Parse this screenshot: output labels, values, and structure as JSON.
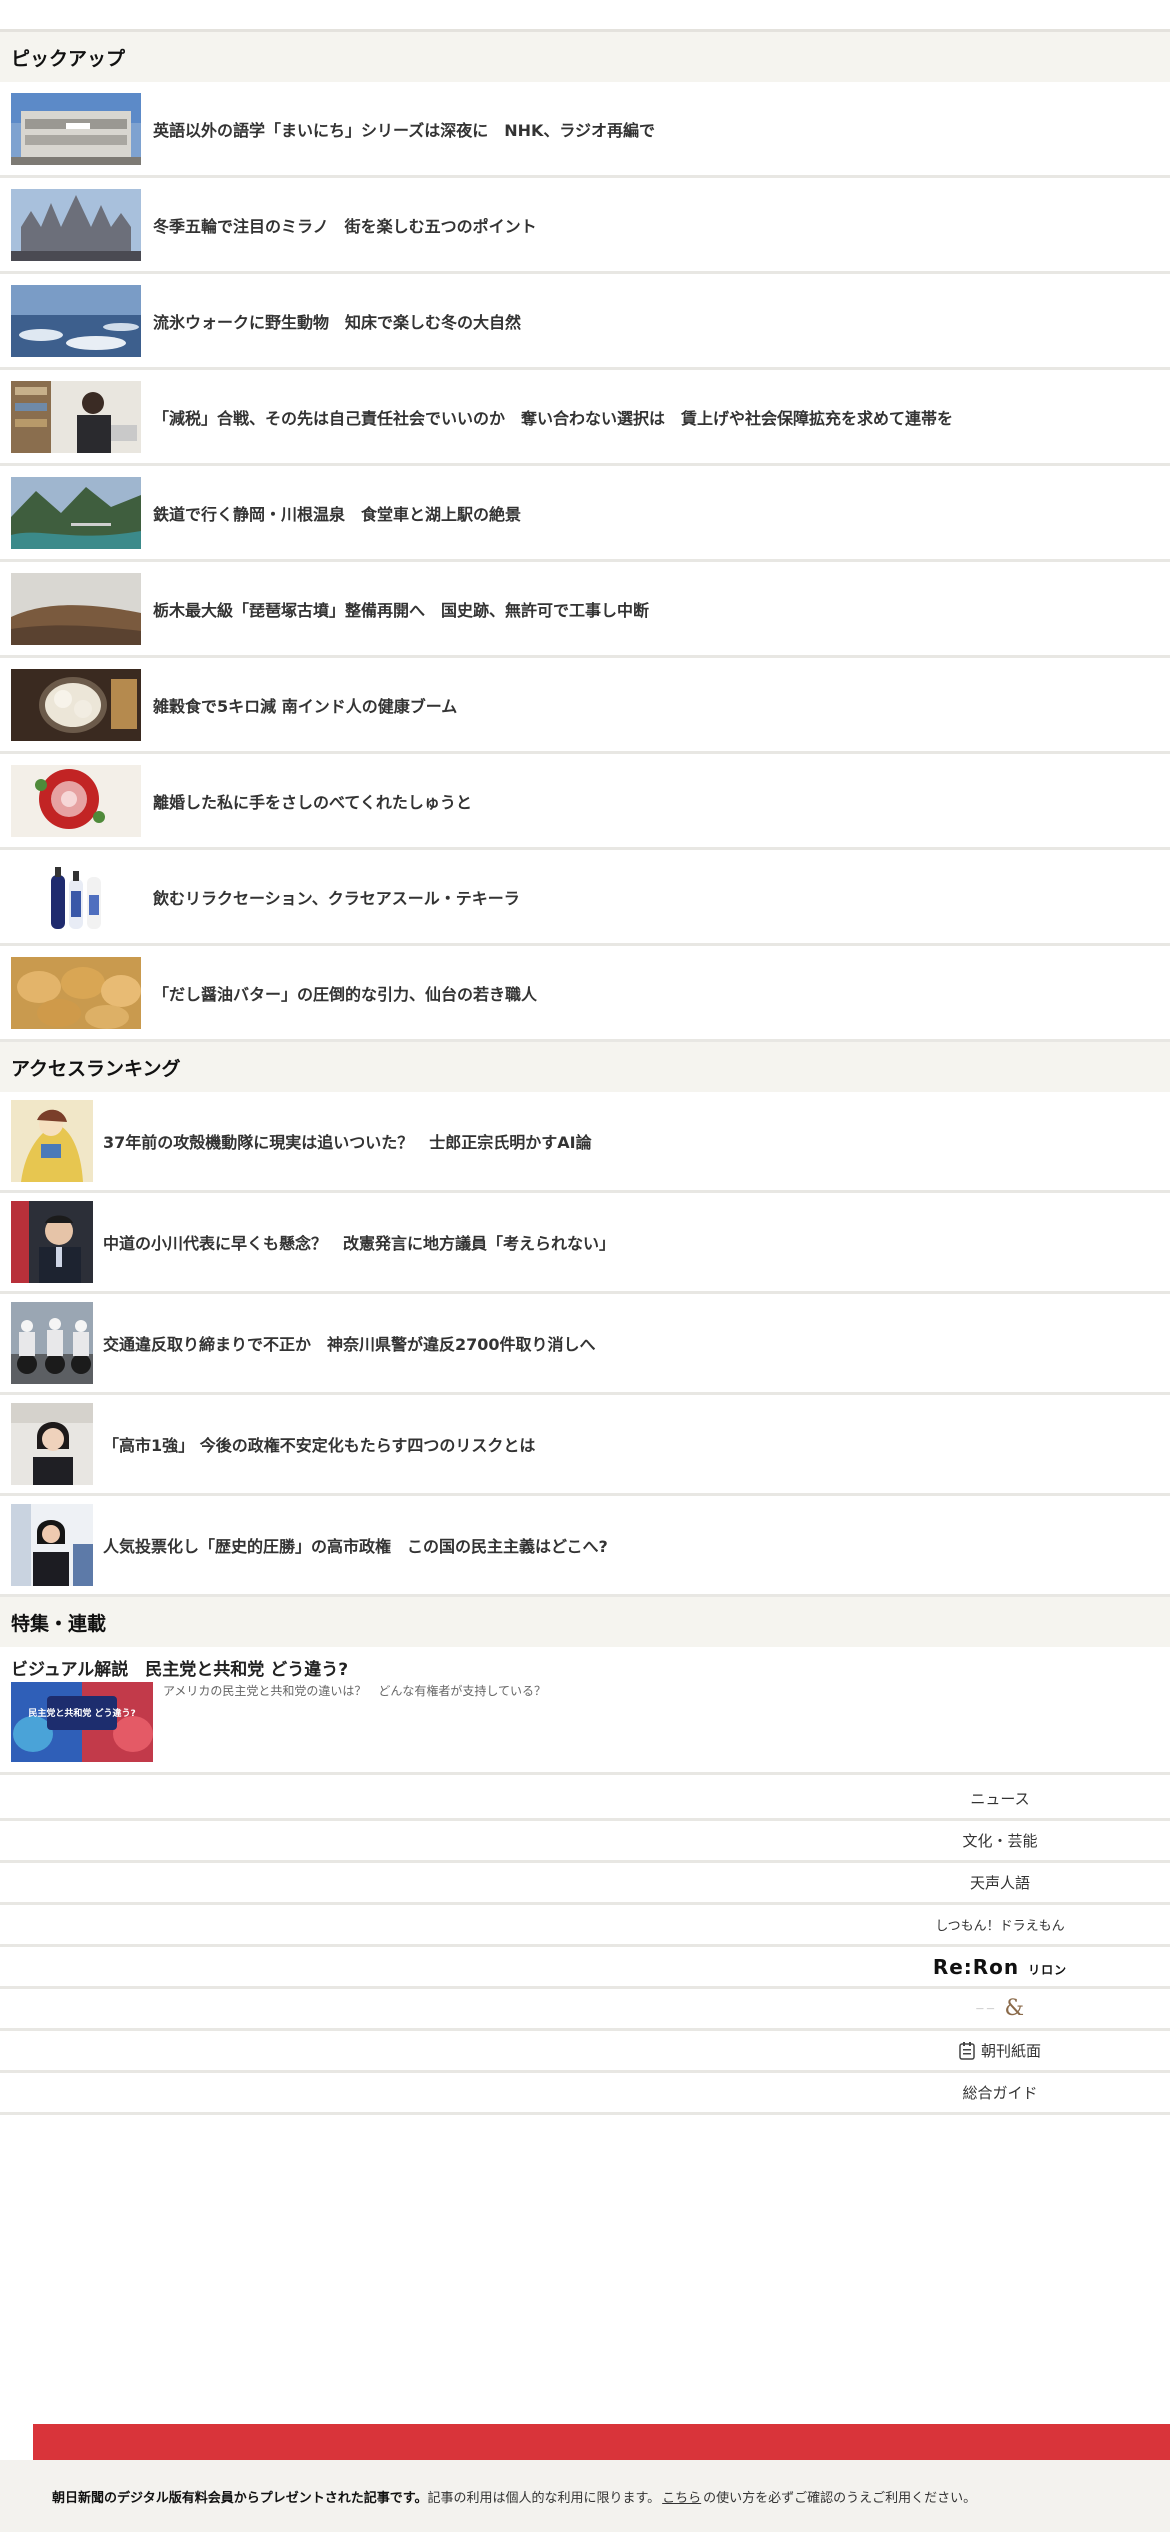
{
  "pickup": {
    "header": "ピックアップ",
    "items": [
      {
        "title": "英語以外の語学「まいにち」シリーズは深夜に　NHK、ラジオ再編で"
      },
      {
        "title": "冬季五輪で注目のミラノ　街を楽しむ五つのポイント"
      },
      {
        "title": "流氷ウォークに野生動物　知床で楽しむ冬の大自然"
      },
      {
        "title": "「減税」合戦、その先は自己責任社会でいいのか　奪い合わない選択は　賃上げや社会保障拡充を求めて連帯を"
      },
      {
        "title": "鉄道で行く静岡・川根温泉　食堂車と湖上駅の絶景"
      },
      {
        "title": "栃木最大級「琵琶塚古墳」整備再開へ　国史跡、無許可で工事し中断"
      },
      {
        "title": "雑穀食で5キロ減 南インド人の健康ブーム"
      },
      {
        "title": "離婚した私に手をさしのべてくれたしゅうと"
      },
      {
        "title": "飲むリラクセーション、クラセアスール・テキーラ"
      },
      {
        "title": "「だし醤油バター」の圧倒的な引力、仙台の若き職人"
      }
    ]
  },
  "ranking": {
    "header": "アクセスランキング",
    "items": [
      {
        "title": "37年前の攻殻機動隊に現実は追いついた？　士郎正宗氏明かすAI論"
      },
      {
        "title": "中道の小川代表に早くも懸念？　改憲発言に地方議員「考えられない」"
      },
      {
        "title": "交通違反取り締まりで不正か　神奈川県警が違反2700件取り消しへ"
      },
      {
        "title": "「高市1強」 今後の政権不安定化もたらす四つのリスクとは"
      },
      {
        "title": "人気投票化し「歴史的圧勝」の高市政権　この国の民主主義はどこへ?"
      }
    ]
  },
  "feature": {
    "header": "特集・連載",
    "title": "ビジュアル解説　民主党と共和党 どう違う?",
    "description": "アメリカの民主党と共和党の違いは？　どんな有権者が支持している？",
    "thumb_text": "民主党と共和党 どう違う?"
  },
  "nav": {
    "items": [
      "ニュース",
      "文化・芸能",
      "天声人語",
      "しつもん！ドラえもん"
    ],
    "reron": "Re:Ron",
    "reron_kana": "リロン",
    "andplus": "&",
    "chokan": "朝刊紙面",
    "guide": "総合ガイド"
  },
  "footer": {
    "bold": "朝日新聞のデジタル版有料会員からプレゼントされた記事です。",
    "text1": "記事の利用は個人的な利用に限ります。",
    "link": "こちら",
    "text2": "の使い方を必ずご確認のうえご利用ください。"
  }
}
